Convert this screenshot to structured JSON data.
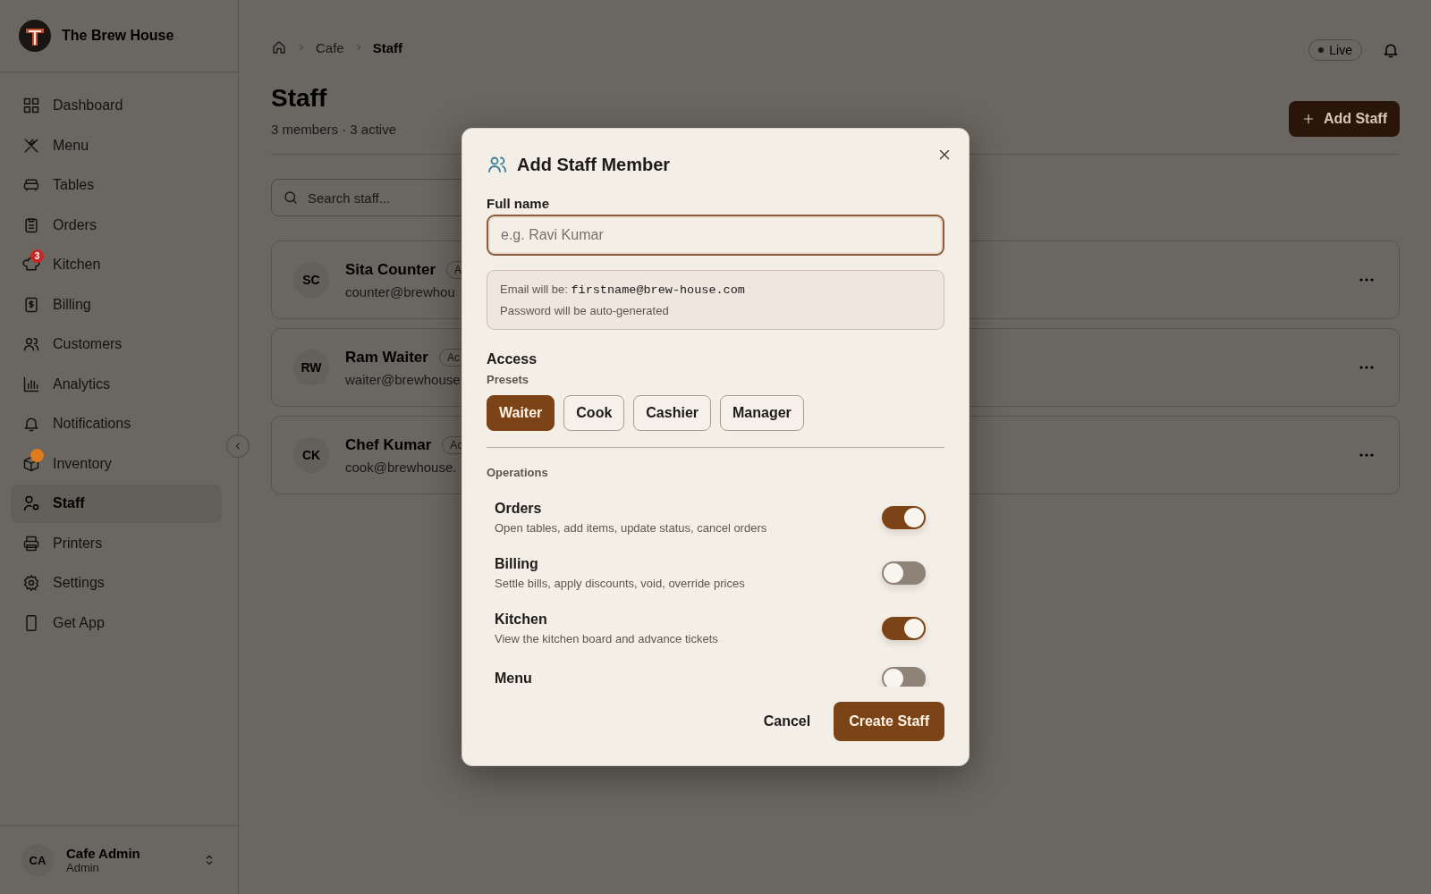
{
  "brand": {
    "name": "The Brew House"
  },
  "sidebar": {
    "items": [
      {
        "label": "Dashboard",
        "selected": false
      },
      {
        "label": "Menu",
        "selected": false
      },
      {
        "label": "Tables",
        "selected": false
      },
      {
        "label": "Orders",
        "selected": false
      },
      {
        "label": "Kitchen",
        "selected": false,
        "badge": {
          "text": "3",
          "color": "#c62828"
        }
      },
      {
        "label": "Billing",
        "selected": false
      },
      {
        "label": "Customers",
        "selected": false
      },
      {
        "label": "Analytics",
        "selected": false
      },
      {
        "label": "Notifications",
        "selected": false
      },
      {
        "label": "Inventory",
        "selected": false,
        "badge": {
          "color": "#e07a1f"
        }
      },
      {
        "label": "Staff",
        "selected": true
      },
      {
        "label": "Printers",
        "selected": false
      },
      {
        "label": "Settings",
        "selected": false
      },
      {
        "label": "Get App",
        "selected": false
      }
    ],
    "user": {
      "initials": "CA",
      "name": "Cafe Admin",
      "role": "Admin"
    }
  },
  "header": {
    "breadcrumb": [
      "Cafe",
      "Staff"
    ],
    "live": "Live"
  },
  "page": {
    "title": "Staff",
    "subtitle": "3 members · 3 active",
    "add_button": "Add Staff",
    "search": {
      "placeholder": "Search staff..."
    },
    "staff": [
      {
        "initials": "SC",
        "name": "Sita Counter",
        "badge": "A",
        "email": "counter@brewhou"
      },
      {
        "initials": "RW",
        "name": "Ram Waiter",
        "badge": "Ac",
        "email": "waiter@brewhouse"
      },
      {
        "initials": "CK",
        "name": "Chef Kumar",
        "badge": "Ac",
        "email": "cook@brewhouse."
      }
    ]
  },
  "modal": {
    "title": "Add Staff Member",
    "name_label": "Full name",
    "name_field": {
      "placeholder": "e.g. Ravi Kumar"
    },
    "info": {
      "email_prefix": "Email will be:",
      "email": "firstname@brew-house.com",
      "password_note": "Password will be auto-generated"
    },
    "access_label": "Access",
    "presets_label": "Presets",
    "presets": [
      {
        "label": "Waiter",
        "selected": true
      },
      {
        "label": "Cook",
        "selected": false
      },
      {
        "label": "Cashier",
        "selected": false
      },
      {
        "label": "Manager",
        "selected": false
      }
    ],
    "section": "Operations",
    "permissions": [
      {
        "title": "Orders",
        "description": "Open tables, add items, update status, cancel orders",
        "on": true
      },
      {
        "title": "Billing",
        "description": "Settle bills, apply discounts, void, override prices",
        "on": false
      },
      {
        "title": "Kitchen",
        "description": "View the kitchen board and advance tickets",
        "on": true
      },
      {
        "title": "Menu",
        "on": false
      }
    ],
    "cancel": "Cancel",
    "create": "Create Staff"
  }
}
